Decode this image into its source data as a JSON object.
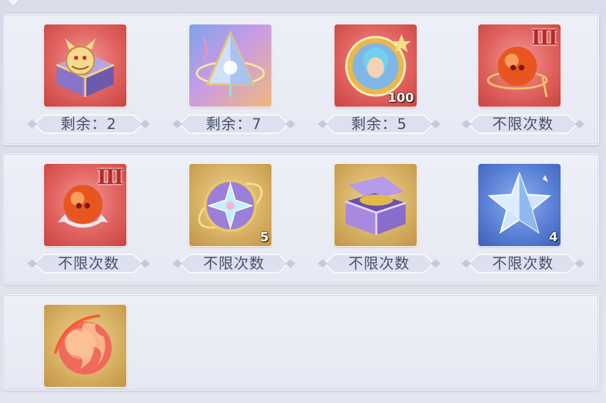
{
  "rows": [
    [
      {
        "icon": "dragon-chest-icon",
        "bg": "red",
        "label": "剩余：2"
      },
      {
        "icon": "arcane-pyramid-icon",
        "bg": "purple",
        "label": "剩余：7"
      },
      {
        "icon": "hero-portrait-medal-icon",
        "bg": "red",
        "label": "剩余：5",
        "count": "100"
      },
      {
        "icon": "fire-orb-icon",
        "bg": "red",
        "label": "不限次数",
        "tier": "III"
      }
    ],
    [
      {
        "icon": "fire-orb-icon",
        "bg": "red",
        "label": "不限次数",
        "tier": "III"
      },
      {
        "icon": "star-compass-icon",
        "bg": "gold",
        "label": "不限次数",
        "count": "5"
      },
      {
        "icon": "open-chest-icon",
        "bg": "gold",
        "label": "不限次数"
      },
      {
        "icon": "ice-star-icon",
        "bg": "blue",
        "label": "不限次数",
        "count": "4"
      }
    ],
    [
      {
        "icon": "flame-sphere-icon",
        "bg": "gold"
      }
    ]
  ]
}
